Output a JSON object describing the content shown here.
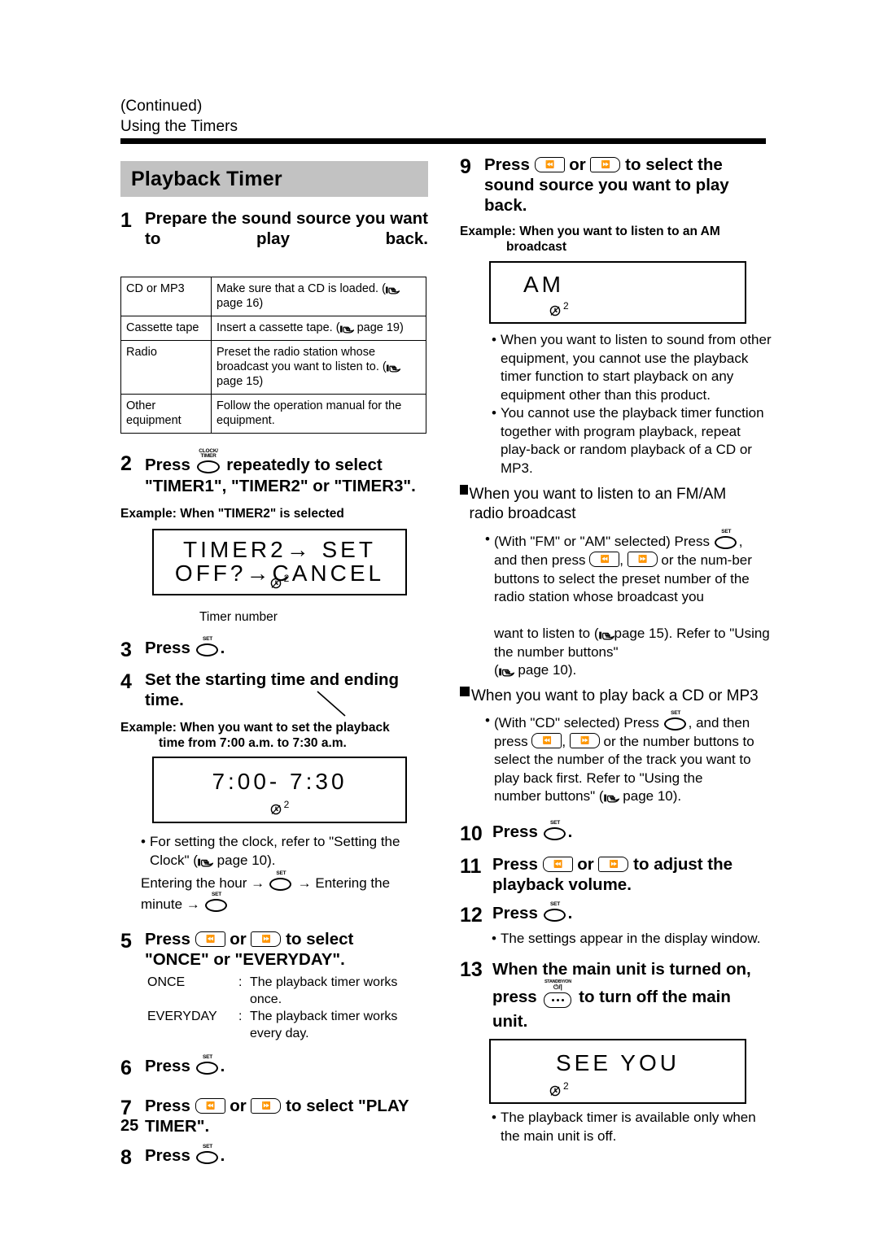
{
  "header": {
    "continued": "(Continued)",
    "section": "Using the Timers"
  },
  "page_number": "25",
  "title_bar": {
    "label": "Playback Timer"
  },
  "left_column": {
    "step1": {
      "number": "1",
      "text": "Prepare the sound source you want to play back."
    },
    "source_table": {
      "rows": [
        {
          "source": "CD or MP3",
          "instruction_a": "Make sure that a CD is loaded. (",
          "instruction_b": "page 16)"
        },
        {
          "source": "Cassette tape",
          "instruction_a": "Insert a cassette tape. (",
          "instruction_b": "page 19)"
        },
        {
          "source": "Radio",
          "instruction_a": "Preset the radio station whose broadcast you want to listen to. (",
          "instruction_b": "page 15)"
        },
        {
          "source": "Other equipment",
          "instruction_a": "Follow the operation manual for the equipment.",
          "instruction_b": ""
        }
      ]
    },
    "step2": {
      "number": "2",
      "press": "Press",
      "button": {
        "name": "clock-timer-button",
        "line1": "CLOCK/",
        "line2": "TIMER"
      },
      "text_a": "repeatedly to select",
      "text_b": "\"TIMER1\", \"TIMER2\" or \"TIMER3\".",
      "example": "Example: When \"TIMER2\" is selected",
      "display": {
        "line1": "TIMER2→ SET",
        "line2": "OFF?→CANCEL",
        "timer_number": "2"
      },
      "callout": "Timer number"
    },
    "step3": {
      "number": "3",
      "press": "Press",
      "button": {
        "name": "set-button",
        "label": "SET"
      },
      "period": "."
    },
    "step4": {
      "number": "4",
      "text": "Set the starting time and ending time.",
      "example_line1": "Example: When you want to set the playback",
      "example_line2": "time from 7:00 a.m. to 7:30 a.m.",
      "display": {
        "line1": "7:00- 7:30",
        "timer_number": "2"
      }
    },
    "notes4": {
      "bullet_a": "For setting the clock, refer to \"Setting the",
      "bullet_b": "Clock\" (",
      "bullet_c": "page 10).",
      "flow_a": "Entering the hour",
      "flow_b": "Entering the",
      "flow_c": "minute"
    },
    "step5": {
      "number": "5",
      "press": "Press",
      "or": "or",
      "text_a": "to select",
      "text_b": "\"ONCE\" or \"EVERYDAY\".",
      "definitions": [
        {
          "term": "ONCE",
          "sep": ":",
          "desc": "The playback timer works once."
        },
        {
          "term": "EVERYDAY",
          "sep": ":",
          "desc": "The playback timer works every day."
        }
      ]
    },
    "step6": {
      "number": "6",
      "press": "Press",
      "period": "."
    },
    "step7": {
      "number": "7",
      "press": "Press",
      "or": "or",
      "text_a": "to select \"PLAY",
      "text_b": "TIMER\"."
    },
    "step8": {
      "number": "8",
      "press": "Press",
      "period": "."
    }
  },
  "right_column": {
    "step9": {
      "number": "9",
      "press": "Press",
      "or": "or",
      "text": "to select the sound source you want to play back.",
      "example_line1": "Example: When you want to listen to an AM",
      "example_line2": "broadcast",
      "display": {
        "line1": "AM",
        "timer_number": "2"
      }
    },
    "notes9": [
      "When you want to listen to sound from other equipment, you cannot use the playback timer function to start playback on any equipment other than this product.",
      "You cannot use the playback timer function together with program playback, repeat play-back or random playback of a CD or MP3."
    ],
    "fmam": {
      "heading": "When you want to listen to an FM/AM radio broadcast",
      "t1": "(With \"FM\" or \"AM\" selected) Press",
      "t2": ",",
      "t3": "and then press",
      "t4": ",",
      "t5": "or the num-ber buttons to select the preset number of the radio station whose broadcast you",
      "t6": "want to listen to (",
      "t7": "page 15). Refer to \"Using the number buttons\"",
      "t8": "(",
      "t9": "page 10)."
    },
    "cdmp3": {
      "heading": "When you want to play back a CD or MP3",
      "t1": "(With \"CD\" selected) Press",
      "t2": ", and then",
      "t3": "press",
      "t4": ",",
      "t5": "or the number buttons to select the number of the track you want to play back first. Refer to \"Using the",
      "t6": "number buttons\" (",
      "t7": "page 10)."
    },
    "step10": {
      "number": "10",
      "press": "Press",
      "period": "."
    },
    "step11": {
      "number": "11",
      "press": "Press",
      "or": "or",
      "text_a": "to adjust the",
      "text_b": "playback volume."
    },
    "step12": {
      "number": "12",
      "press": "Press",
      "period": ".",
      "note": "The settings appear in the display window."
    },
    "step13": {
      "number": "13",
      "text_a": "When the main unit is turned on,",
      "press": "press",
      "button": {
        "name": "standby-on-button",
        "line1": "STANDBY/ON",
        "line2": "⏻/|"
      },
      "text_b": "to turn off the main unit.",
      "display": {
        "line1": "SEE YOU",
        "timer_number": "2"
      },
      "note": "The playback timer is available only when the main unit is off."
    }
  },
  "icons": {
    "set_button": "set-button",
    "clock_timer_button": "clock-timer-button",
    "skip_prev_button": "skip-previous-button",
    "skip_next_button": "skip-next-button",
    "standby_on_button": "standby-on-button",
    "reference_hand": "pointing-hand-icon",
    "clock": "clock-icon"
  },
  "colors": {
    "title_bar_bg": "#c2c2c2",
    "rule": "#000000",
    "text": "#000000"
  }
}
